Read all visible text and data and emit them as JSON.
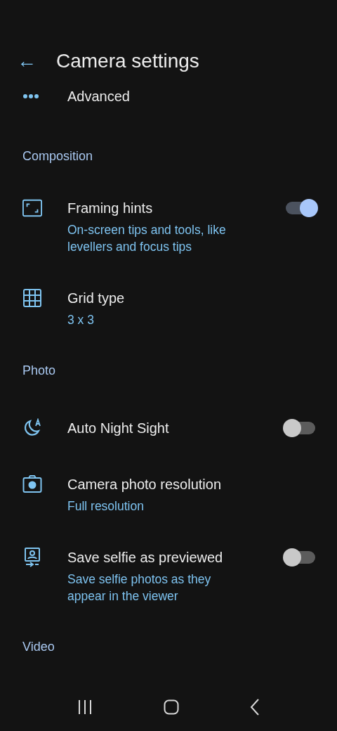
{
  "app_bar": {
    "back": "←",
    "title": "Camera settings"
  },
  "sections": [
    {
      "items": [
        {
          "title": "Advanced"
        }
      ]
    },
    {
      "header": "Composition",
      "items": [
        {
          "title": "Framing hints",
          "subtitle": "On-screen tips and tools, like levellers and focus tips",
          "on": true
        },
        {
          "title": "Grid type",
          "subtitle": "3 x 3"
        }
      ]
    },
    {
      "header": "Photo",
      "items": [
        {
          "title": "Auto Night Sight",
          "on": false
        },
        {
          "title": "Camera photo resolution",
          "subtitle": "Full resolution"
        },
        {
          "title": "Save selfie as previewed",
          "subtitle": "Save selfie photos as they appear in the viewer",
          "on": false
        }
      ]
    },
    {
      "header": "Video"
    }
  ]
}
